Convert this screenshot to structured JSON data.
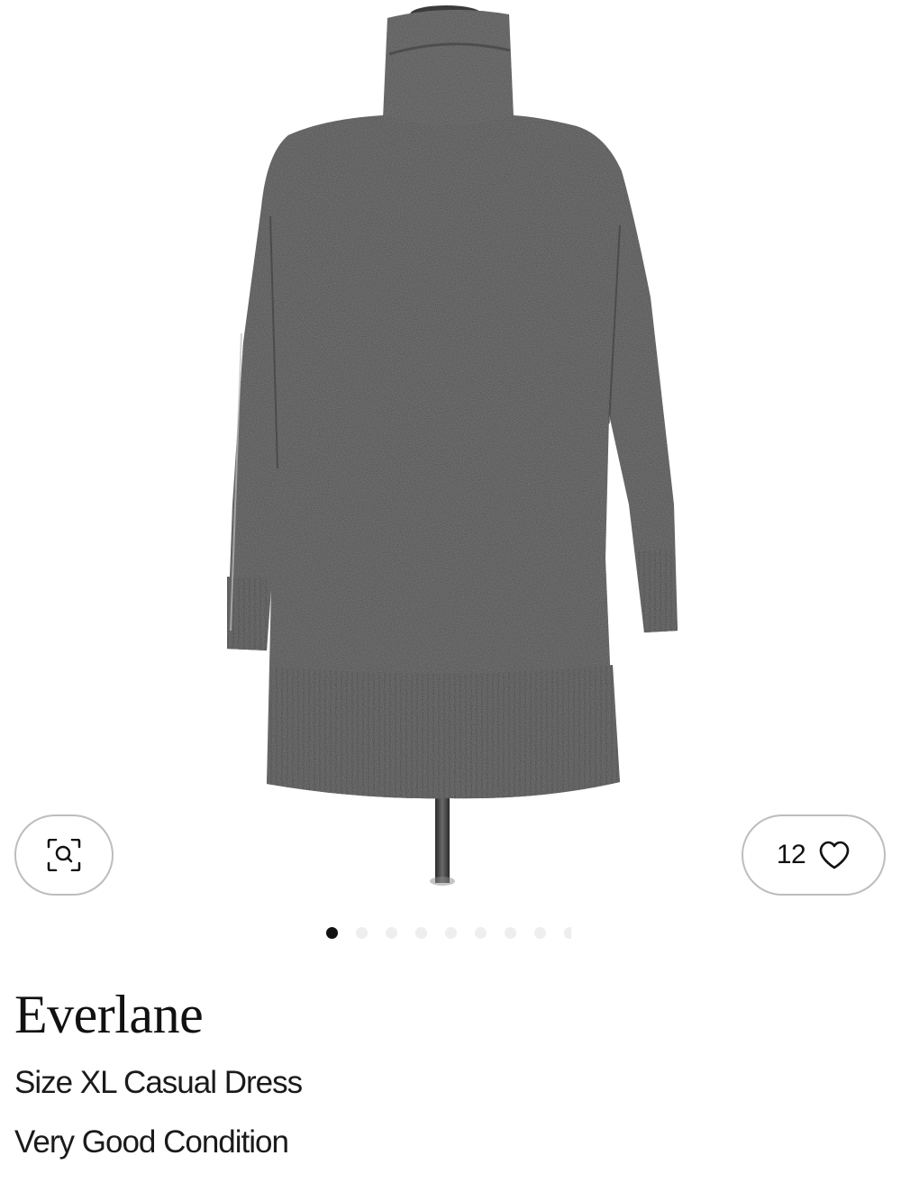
{
  "product": {
    "image_alt": "Gray turtleneck sweater dress on mannequin",
    "brand": "Everlane",
    "size_line": "Size XL Casual Dress",
    "condition_line": "Very Good Condition",
    "favorites_count": "12"
  },
  "carousel": {
    "total_dots": 9,
    "active_index": 0
  },
  "icons": {
    "zoom": "image-search-icon",
    "favorite": "heart-outline-icon"
  },
  "colors": {
    "garment": "#4a4a4a",
    "pill_border": "#bdbdbd",
    "dot_active": "#111111",
    "dot_inactive": "#eeeeee"
  }
}
